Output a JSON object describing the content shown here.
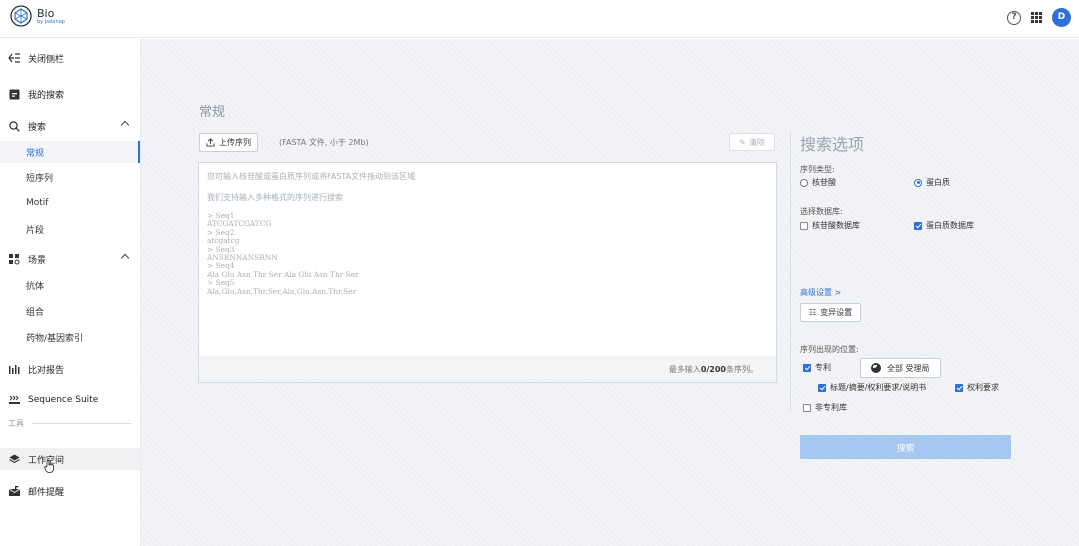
{
  "app": {
    "name": "Bio",
    "byline": "by patsnap",
    "avatar_initial": "D",
    "accent_color": "#2f6fd6"
  },
  "topbar": {
    "help_icon": "help-circle-icon",
    "apps_icon": "grid-apps-icon"
  },
  "sidebar": {
    "collapse_label": "关闭侧栏",
    "my_search": "我的搜索",
    "search_group": "搜索",
    "search_items": [
      "常规",
      "短序列",
      "Motif",
      "片段"
    ],
    "scene_group": "场景",
    "scene_items": [
      "抗体",
      "组合",
      "药物/基因索引"
    ],
    "compare_report": "比对报告",
    "sequence_suite": "Sequence Suite",
    "tools_section": "工具",
    "workspace": "工作空间",
    "mail_alert": "邮件提醒"
  },
  "main": {
    "page_title": "常规",
    "upload_button": "上传序列",
    "upload_hint": "(FASTA 文件, 小于 2Mb)",
    "clear_button": "清除",
    "seq_hint_line1": "您可输入核苷酸或蛋白质序列或将FASTA文件拖动到该区域",
    "seq_hint_line2": "我们支持输入多种格式的序列进行搜索",
    "seq_example": "> Seq1\nATCGATCGATCG\n> Seq2\natcgatcg\n> Seq3\nANSRNNANSRNN\n> Seq4\nAla Glu Asn Thr Ser Ala Glu Asn Thr Ser\n> Seq5\nAla,Glu,Asn,Thr,Ser,Ala,Glu,Asn,Thr,Ser",
    "count_prefix": "最多输入",
    "count_value": "0/200",
    "count_suffix": "条序列。"
  },
  "options": {
    "title": "搜索选项",
    "seq_type_label": "序列类型:",
    "seq_type_nucleotide": "核苷酸",
    "seq_type_protein": "蛋白质",
    "seq_type_selected": "protein",
    "db_label": "选择数据库:",
    "db_nucleotide": "核苷酸数据库",
    "db_protein": "蛋白质数据库",
    "advanced_link": "高级设置 >",
    "variant_button": "变异设置",
    "position_label": "序列出现的位置:",
    "patent": "专利",
    "authority_button": "全部 受理局",
    "title_abstract": "标题/摘要/权利要求/说明书",
    "claims": "权利要求",
    "non_patent": "非专利库",
    "search_button": "搜索"
  }
}
